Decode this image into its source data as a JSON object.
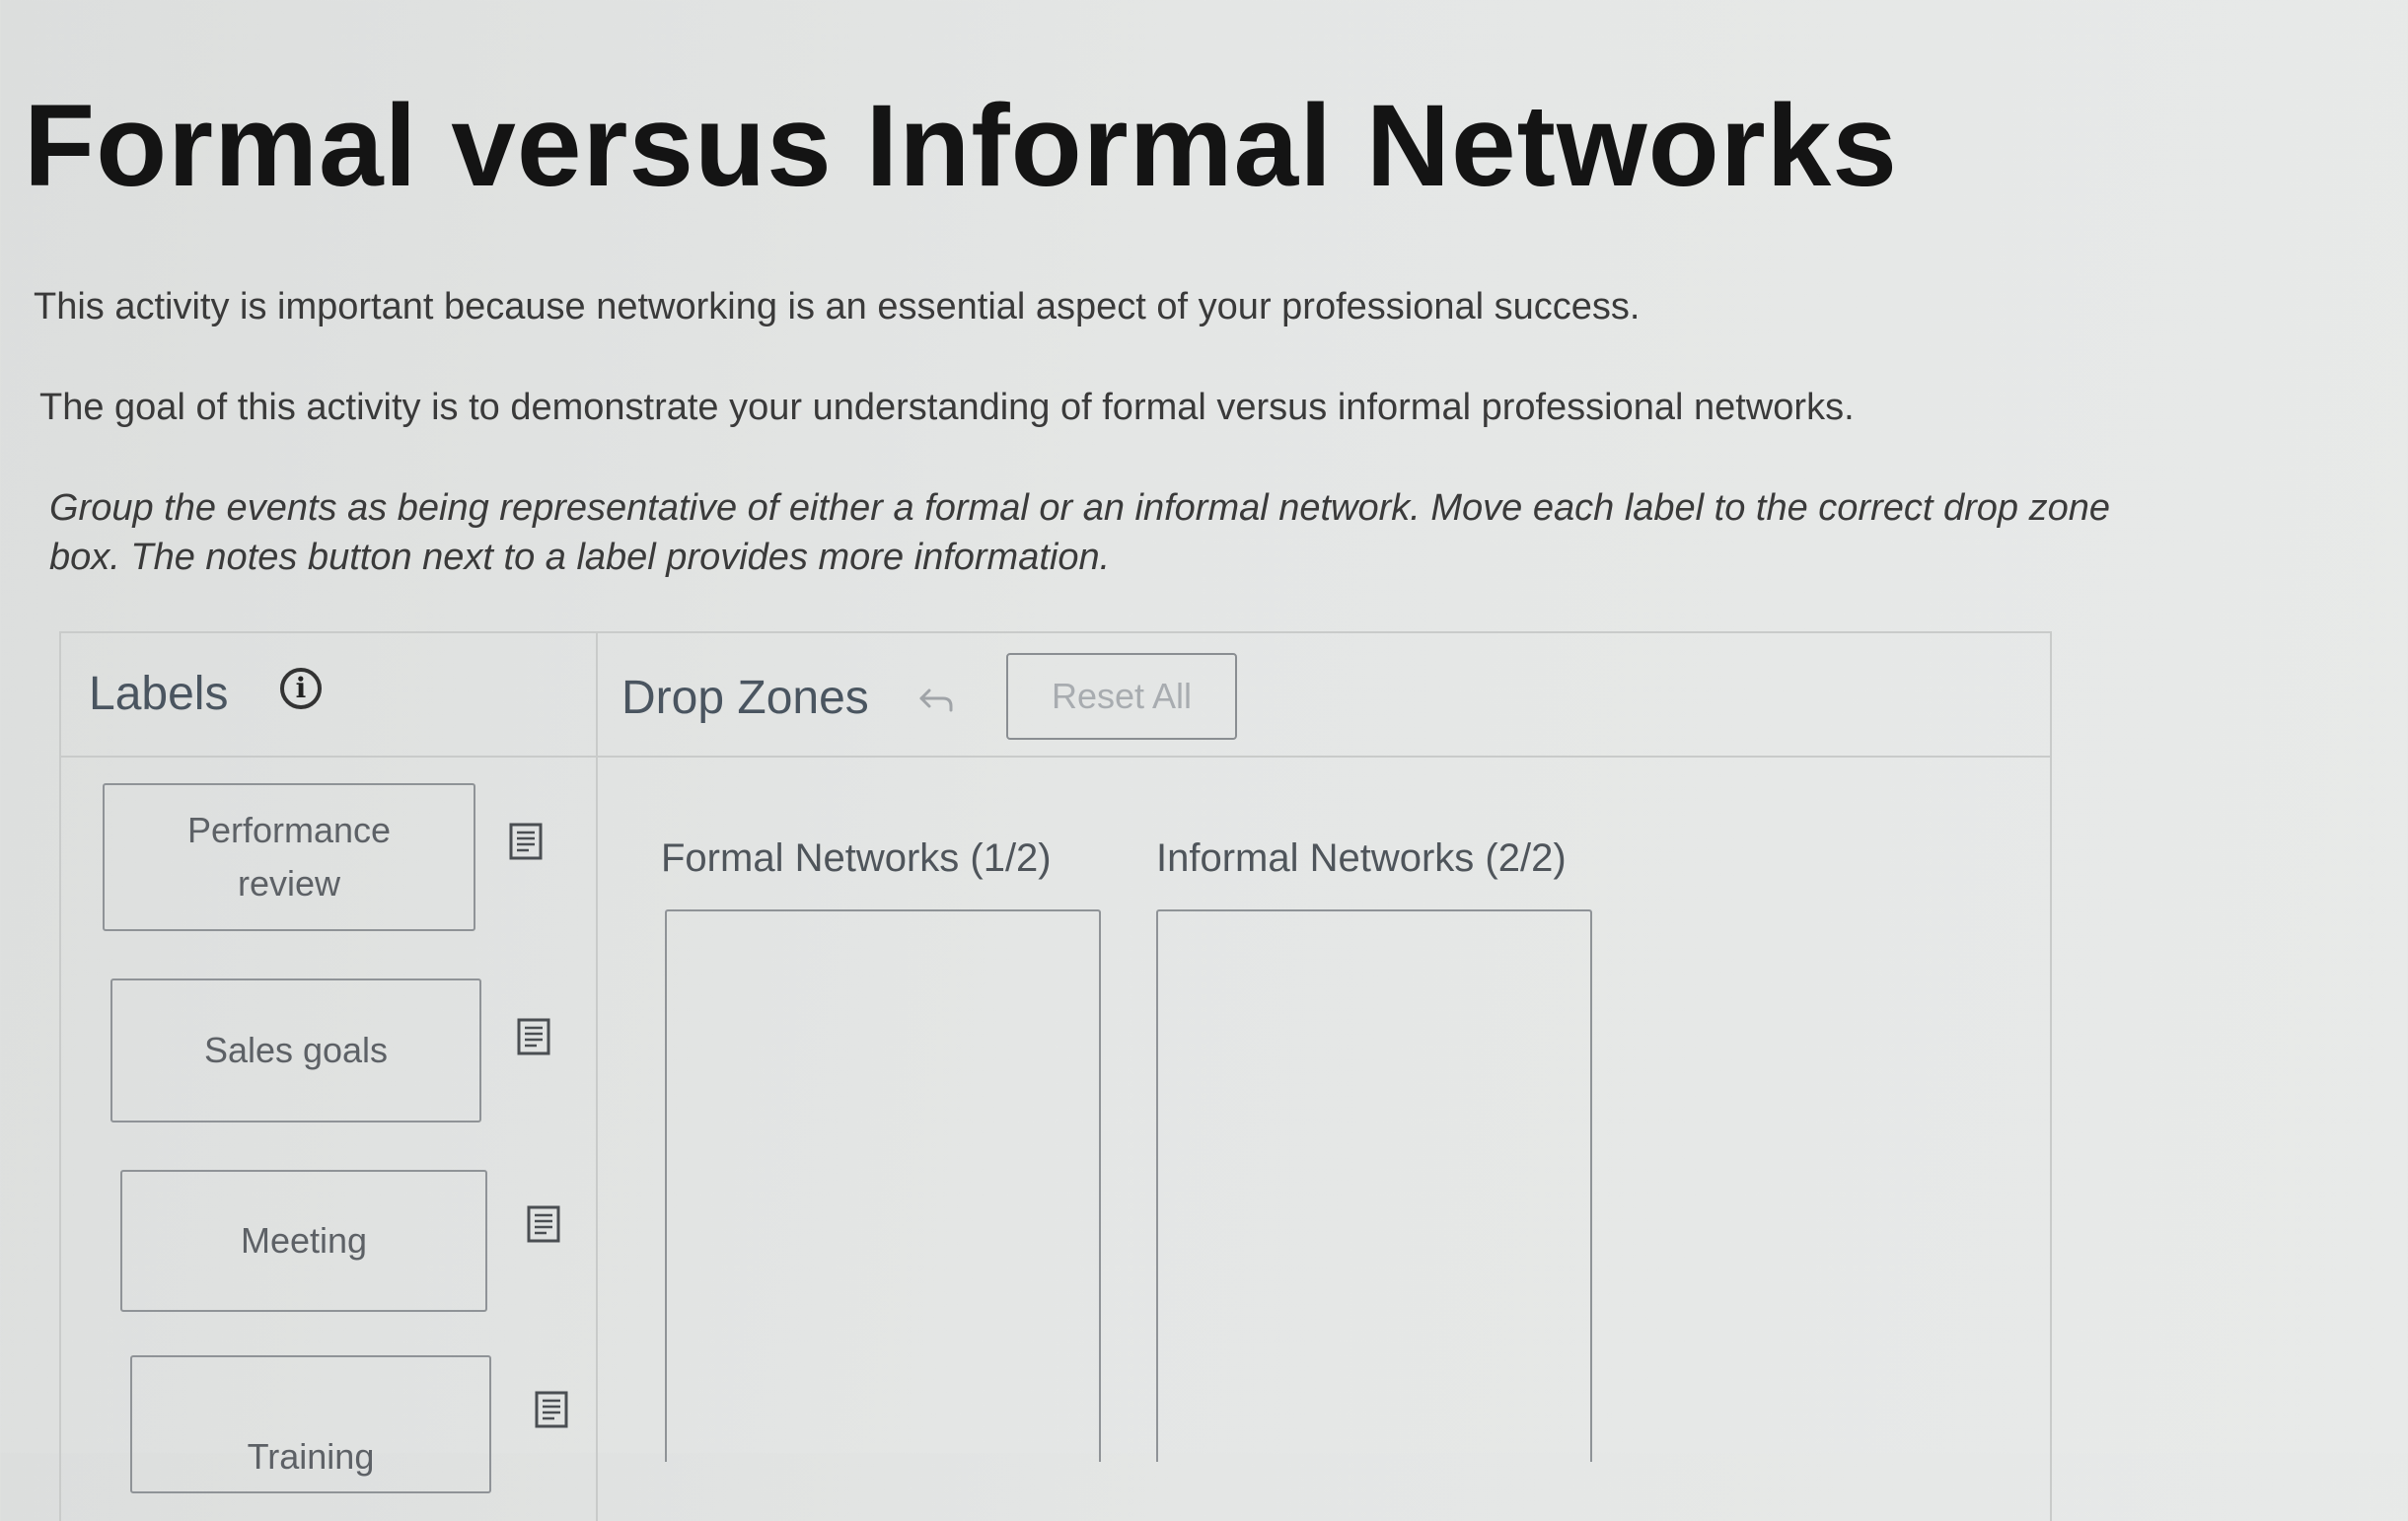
{
  "page": {
    "title": "Formal versus Informal Networks",
    "intro_1": "This activity is important because networking is an essential aspect of your professional success.",
    "intro_2": "The goal of this activity is  to demonstrate your understanding of formal versus informal professional networks.",
    "instructions": "Group the events as being representative of either a formal or an informal network. Move each label to the correct drop zone box. The notes button next to a label provides more information."
  },
  "labels_panel": {
    "title": "Labels",
    "info_icon": "info-circle-icon",
    "items": [
      {
        "label": "Performance review",
        "notes_icon": "notes-icon"
      },
      {
        "label": "Sales goals",
        "notes_icon": "notes-icon"
      },
      {
        "label": "Meeting",
        "notes_icon": "notes-icon"
      },
      {
        "label": "Training",
        "notes_icon": "notes-icon"
      }
    ]
  },
  "dropzones_panel": {
    "title": "Drop Zones",
    "undo_icon": "undo-arrow-icon",
    "reset_label": "Reset All",
    "zones": [
      {
        "label": "Formal Networks (1/2)"
      },
      {
        "label": "Informal Networks (2/2)"
      }
    ]
  }
}
